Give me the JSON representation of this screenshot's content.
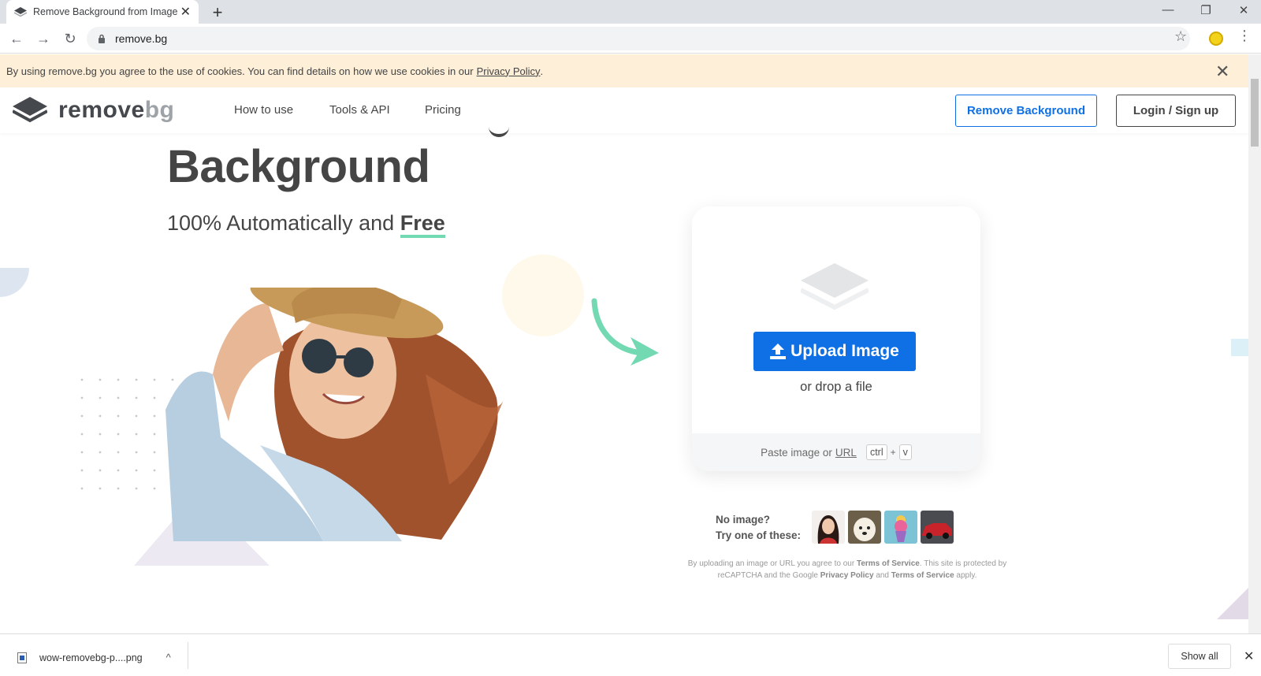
{
  "browser": {
    "tab_title": "Remove Background from Image",
    "tab_close": "✕",
    "new_tab": "+",
    "minimize": "—",
    "restore": "❐",
    "close": "✕",
    "url": "remove.bg",
    "back": "←",
    "forward": "→",
    "reload": "↻",
    "star": "☆",
    "menu": "⋮"
  },
  "cookie_bar": {
    "text": "By using remove.bg you agree to the use of cookies. You can find details on how we use cookies in our",
    "link": "Privacy Policy",
    "suffix": ".",
    "close": "✕"
  },
  "header": {
    "logo_text_1": "remove",
    "logo_text_2": "bg",
    "nav": [
      "How to use",
      "Tools & API",
      "Pricing"
    ],
    "remove_button": "Remove Background",
    "login_button": "Login / Sign up"
  },
  "hero": {
    "headline": "Background",
    "subline_prefix": "100% Automatically and",
    "subline_free": "Free"
  },
  "upload": {
    "button": "Upload Image",
    "drop_text": "or drop a file",
    "paste_text": "Paste image or",
    "url_link": "URL",
    "key_ctrl": "ctrl",
    "key_plus": "+",
    "key_v": "v"
  },
  "samples": {
    "line1": "No image?",
    "line2": "Try one of these:"
  },
  "terms": {
    "t1": "By uploading an image or URL you agree to our",
    "tos": "Terms of Service",
    "t2": ". This site is protected by reCAPTCHA and the Google",
    "pp": "Privacy Policy",
    "t3": "and",
    "tos2": "Terms of Service",
    "t4": "apply."
  },
  "downloads": {
    "filename": "wow-removebg-p....png",
    "show_all": "Show all",
    "close": "✕",
    "chevron": "^"
  },
  "colors": {
    "accent": "#0f70e6",
    "cookie_bg": "#fdefd8",
    "mint": "#73d9b3"
  }
}
